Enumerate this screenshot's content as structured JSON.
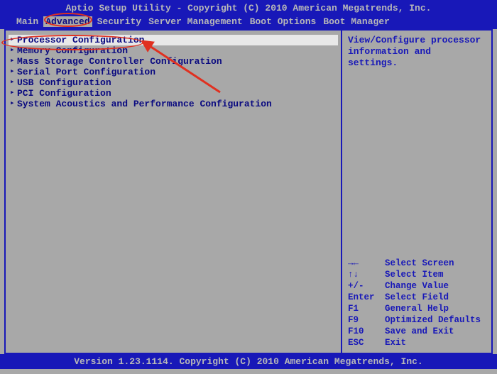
{
  "header": {
    "title": "Aptio Setup Utility - Copyright (C) 2010 American Megatrends, Inc."
  },
  "menubar": {
    "items": [
      {
        "label": "Main"
      },
      {
        "label": "Advanced"
      },
      {
        "label": "Security"
      },
      {
        "label": "Server Management"
      },
      {
        "label": "Boot Options"
      },
      {
        "label": "Boot Manager"
      }
    ],
    "active_index": 1
  },
  "left_pane": {
    "items": [
      {
        "label": "Processor Configuration",
        "selected": true
      },
      {
        "label": "Memory Configuration",
        "selected": false
      },
      {
        "label": "Mass Storage Controller Configuration",
        "selected": false
      },
      {
        "label": "Serial Port Configuration",
        "selected": false
      },
      {
        "label": "USB Configuration",
        "selected": false
      },
      {
        "label": "PCI Configuration",
        "selected": false
      },
      {
        "label": "System Acoustics and Performance Configuration",
        "selected": false
      }
    ]
  },
  "right_pane": {
    "help": "View/Configure processor information and settings."
  },
  "legend": {
    "items": [
      {
        "key": "→←",
        "label": "Select Screen"
      },
      {
        "key": "↑↓",
        "label": "Select Item"
      },
      {
        "key": "+/-",
        "label": "Change Value"
      },
      {
        "key": "Enter",
        "label": "Select Field"
      },
      {
        "key": "F1",
        "label": "General Help"
      },
      {
        "key": "F9",
        "label": "Optimized Defaults"
      },
      {
        "key": "F10",
        "label": "Save and Exit"
      },
      {
        "key": "ESC",
        "label": "Exit"
      }
    ]
  },
  "footer": {
    "text": "Version 1.23.1114. Copyright (C) 2010 American Megatrends, Inc."
  }
}
